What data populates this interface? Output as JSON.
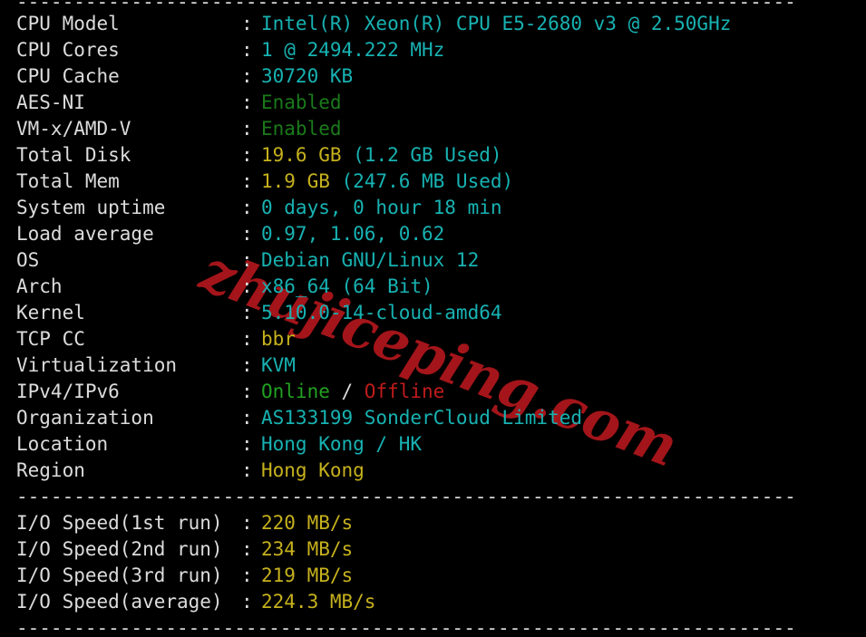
{
  "terminal": {
    "background": "#000000",
    "default_text_color": "#dcdcdc",
    "watermark": "zhujiceping.com",
    "watermark_color": "#a3151a",
    "separator_top": "--------------------------------------------------------------------",
    "separator_mid": "--------------------------------------------------------------------",
    "separator_bottom": "--------------------------------------------------------------------",
    "colon": ":"
  },
  "colors": {
    "cyan": "#18b2b2",
    "green": "#1a7a1a",
    "bright_green": "#22a022",
    "yellow": "#c6b11d",
    "red": "#c01b1b",
    "white": "#dcdcdc"
  },
  "sysinfo": {
    "rows": [
      {
        "label": "CPU Model",
        "value": "Intel(R) Xeon(R) CPU E5-2680 v3 @ 2.50GHz"
      },
      {
        "label": "CPU Cores",
        "value": "1 @ 2494.222 MHz"
      },
      {
        "label": "CPU Cache",
        "value": "30720 KB"
      },
      {
        "label": "AES-NI",
        "value": "Enabled"
      },
      {
        "label": "VM-x/AMD-V",
        "value": "Enabled"
      },
      {
        "label": "Total Disk",
        "value": "19.6 GB",
        "value2": " (1.2 GB Used)"
      },
      {
        "label": "Total Mem",
        "value": "1.9 GB",
        "value2": " (247.6 MB Used)"
      },
      {
        "label": "System uptime",
        "value": "0 days, 0 hour 18 min"
      },
      {
        "label": "Load average",
        "value": "0.97, 1.06, 0.62"
      },
      {
        "label": "OS",
        "value": "Debian GNU/Linux 12"
      },
      {
        "label": "Arch",
        "value": "x86_64 (64 Bit)"
      },
      {
        "label": "Kernel",
        "value": "5.10.0-14-cloud-amd64"
      },
      {
        "label": "TCP CC",
        "value": "bbr"
      },
      {
        "label": "Virtualization",
        "value": "KVM"
      },
      {
        "label": "IPv4/IPv6",
        "value": "Online",
        "value2": " / ",
        "value3": "Offline"
      },
      {
        "label": "Organization",
        "value": "AS133199 SonderCloud Limited"
      },
      {
        "label": "Location",
        "value": "Hong Kong / HK"
      },
      {
        "label": "Region",
        "value": "Hong Kong"
      }
    ]
  },
  "iospeed": {
    "rows": [
      {
        "label": "I/O Speed(1st run)",
        "value": "220 MB/s"
      },
      {
        "label": "I/O Speed(2nd run)",
        "value": "234 MB/s"
      },
      {
        "label": "I/O Speed(3rd run)",
        "value": "219 MB/s"
      },
      {
        "label": "I/O Speed(average)",
        "value": "224.3 MB/s"
      }
    ]
  }
}
